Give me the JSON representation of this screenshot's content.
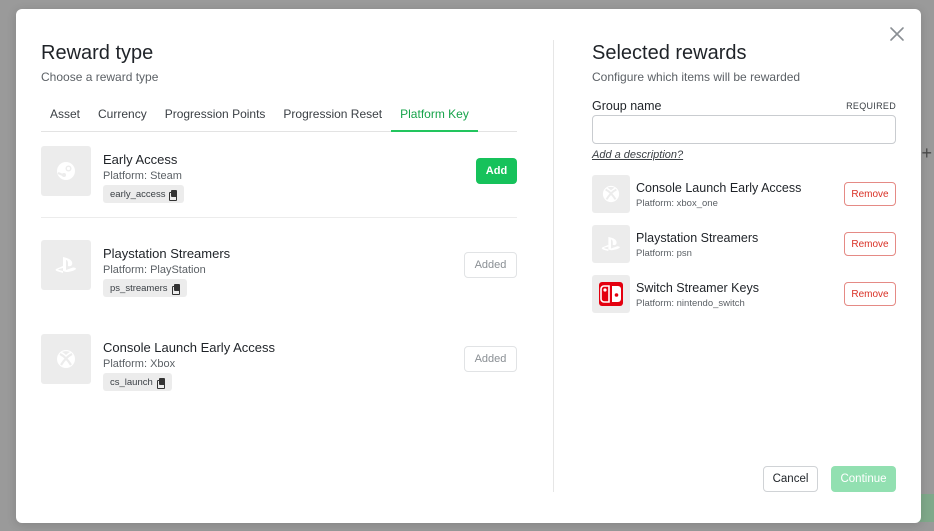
{
  "left": {
    "title": "Reward type",
    "subtitle": "Choose a reward type",
    "tabs": [
      {
        "label": "Asset"
      },
      {
        "label": "Currency"
      },
      {
        "label": "Progression Points"
      },
      {
        "label": "Progression Reset"
      },
      {
        "label": "Platform Key",
        "active": true
      }
    ],
    "items": [
      {
        "name": "Early Access",
        "platform": "Platform: Steam",
        "key": "early_access",
        "icon": "steam-icon",
        "action": "Add"
      },
      {
        "name": "Playstation Streamers",
        "platform": "Platform: PlayStation",
        "key": "ps_streamers",
        "icon": "playstation-icon",
        "action": "Added"
      },
      {
        "name": "Console Launch Early Access",
        "platform": "Platform: Xbox",
        "key": "cs_launch",
        "icon": "xbox-icon",
        "action": "Added"
      }
    ]
  },
  "right": {
    "title": "Selected rewards",
    "subtitle": "Configure which items will be rewarded",
    "group_label": "Group name",
    "required_label": "REQUIRED",
    "group_value": "",
    "description_link": "Add a description?",
    "selected": [
      {
        "name": "Console Launch Early Access",
        "platform": "Platform: xbox_one",
        "icon": "xbox-icon",
        "action": "Remove"
      },
      {
        "name": "Playstation Streamers",
        "platform": "Platform: psn",
        "icon": "playstation-icon",
        "action": "Remove"
      },
      {
        "name": "Switch Streamer Keys",
        "platform": "Platform: nintendo_switch",
        "icon": "nintendo-switch-icon",
        "action": "Remove"
      }
    ],
    "cancel_label": "Cancel",
    "continue_label": "Continue"
  },
  "colors": {
    "accent": "#16c25b",
    "danger": "#d93025",
    "continue_disabled": "#92e0b1"
  }
}
